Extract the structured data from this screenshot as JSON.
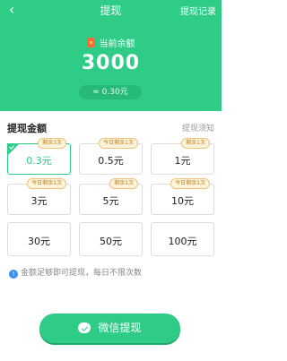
{
  "nav": {
    "title": "提现",
    "records": "提现记录"
  },
  "balance": {
    "label": "当前余额",
    "value": "3000",
    "approx": "≈ 0.30元"
  },
  "section": {
    "title": "提现金额",
    "notice": "提现须知"
  },
  "options": [
    {
      "amount": "0.3元",
      "badge": "剩余3次"
    },
    {
      "amount": "0.5元",
      "badge": "今日剩余1次"
    },
    {
      "amount": "1元",
      "badge": "剩余1次"
    },
    {
      "amount": "3元",
      "badge": "今日剩余1次"
    },
    {
      "amount": "5元",
      "badge": "剩余1次"
    },
    {
      "amount": "10元",
      "badge": "今日剩余1次"
    },
    {
      "amount": "30元",
      "badge": ""
    },
    {
      "amount": "50元",
      "badge": ""
    },
    {
      "amount": "100元",
      "badge": ""
    }
  ],
  "hint": "金额足够即可提现，每日不限次数",
  "button": {
    "label": "微信提现"
  },
  "colors": {
    "primary": "#2ecc86",
    "badge_bg": "#fff4dc",
    "badge_text": "#b77d16",
    "info": "#3c8ff5"
  },
  "icons": {
    "back": "chevron-left-icon",
    "balance": "red-packet-icon",
    "selected": "check-icon",
    "info": "info-icon",
    "wechat": "wechat-icon"
  }
}
